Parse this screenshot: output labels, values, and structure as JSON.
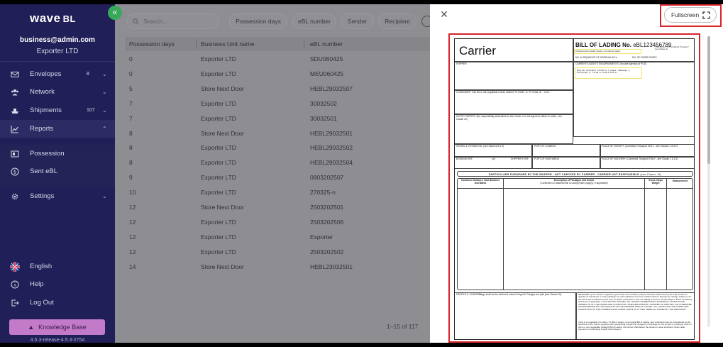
{
  "brand": {
    "name": "wave",
    "suffix": "BL"
  },
  "collapse_icon": "double-chevron-left-icon",
  "account": {
    "email": "business@admin.com",
    "company": "Exporter LTD"
  },
  "nav": [
    {
      "label": "Envelopes",
      "count": "8",
      "icon": "envelope-icon"
    },
    {
      "label": "Network",
      "count": "",
      "icon": "network-icon"
    },
    {
      "label": "Shipments",
      "count": "107",
      "icon": "ship-icon"
    },
    {
      "label": "Reports",
      "count": "",
      "icon": "chart-icon"
    },
    {
      "label": "Possession",
      "icon": "possession-icon"
    },
    {
      "label": "Sent eBL",
      "icon": "dollar-icon"
    },
    {
      "label": "Settings",
      "icon": "gear-icon"
    }
  ],
  "bottom_nav": [
    {
      "label": "English",
      "icon": "uk-flag-icon"
    },
    {
      "label": "Help",
      "icon": "help-icon"
    },
    {
      "label": "Log Out",
      "icon": "logout-icon"
    }
  ],
  "knowledge_base": "Knowledge Base",
  "version": "4.5.3-release-4.5.3-2754",
  "search": {
    "placeholder": "Search..."
  },
  "filters": [
    "Possession days",
    "eBL number",
    "Sender",
    "Recipient"
  ],
  "table": {
    "columns": [
      "Possession days",
      "Business Unit name",
      "eBL number"
    ],
    "rows": [
      [
        "0",
        "Exporter LTD",
        "SDU060425"
      ],
      [
        "0",
        "Exporter LTD",
        "MEU060425"
      ],
      [
        "5",
        "Store Next Door",
        "HEBL29032507"
      ],
      [
        "7",
        "Exporter LTD",
        "30032502"
      ],
      [
        "7",
        "Exporter LTD",
        "30032501"
      ],
      [
        "8",
        "Store Next Door",
        "HEBL29032501"
      ],
      [
        "8",
        "Exporter LTD",
        "HEBL29032502"
      ],
      [
        "8",
        "Exporter LTD",
        "HEBL29032504"
      ],
      [
        "9",
        "Exporter LTD",
        "0803202507"
      ],
      [
        "10",
        "Exporter LTD",
        "270325-n"
      ],
      [
        "12",
        "Store Next Door",
        "2503202501"
      ],
      [
        "12",
        "Exporter LTD",
        "2503202506"
      ],
      [
        "12",
        "Exporter LTD",
        "Exporter"
      ],
      [
        "12",
        "Exporter LTD",
        "2503202502"
      ],
      [
        "14",
        "Store Next Door",
        "HEBL23032501"
      ]
    ]
  },
  "pagination": "1–15 of 117",
  "panel": {
    "fullscreen": "Fullscreen"
  },
  "document": {
    "carrier": "Carrier",
    "title": "BILL OF LADING No.",
    "number": "eBL123456789",
    "port_note": "\"Port-to-Port\" or \"Combined Transport\" (see Clause 1)",
    "original_note": "Original electronically issued, not valid as paper",
    "shipper": "SHIPPER:",
    "seq": "NO. & SEQUENCE OF ORIGINAL B/L's",
    "rider": "NO. OF RIDER PAGES",
    "endorse": "CARRIER'S AGENTS ENDORSEMENTS: (Include Agent(s) at POD)",
    "digital_note": "Digital Document contains 3 pages (Message 1, Riderpage 0, Terms & Conditions 2)",
    "consignee": "CONSIGNEE: This B/L is not negotiable unless marked \"To Order\" or \"To Order of...\" here.",
    "notify": "NOTIFY PARTIES: (No responsibility shall attach to the Carrier or to his Agent for failure to notify - see Clause 20)",
    "vessel": "VESSEL & VOYAGE NO. (see Clauses 8 & 9)",
    "port_loading": "PORT OF LOADING",
    "place_receipt": "PLACE OF RECEIPT: (Combined Transport ONLY - see Clauses 1 & 5.2)",
    "booking": "BOOKING REF.",
    "or": "(or)",
    "shippers_ref": "SHIPPER'S REF.",
    "port_discharge": "PORT OF DISCHARGE",
    "place_delivery": "PLACE OF DELIVERY: (Combined Transport ONLY - see Clause 1 & 5.2)",
    "particulars": "PARTICULARS FURNISHED BY THE SHIPPER - NOT CHECKED BY CARRIER - CARRIER NOT RESPONSIBLE",
    "particulars_note": "(see Clause 14)",
    "col_container": "Container Numbers, Seal Numbers and Marks",
    "col_description": "Description of Packages and Goods",
    "col_description_sub": "(Continued on attached Bill of Lading Rider page(s), if applicable)",
    "col_weight": "Gross Cargo Weight",
    "col_measure": "Measurement",
    "freight": "FREIGHT & CHARGES",
    "freight_note": "Cargo shall not be delivered unless Freight & Charges are paid (see Clause 16).",
    "received": "RECEIVED by the Carrier in apparent good order and condition (unless otherwise stated herein) the total number or quantity of Containers or other packages or units indicated in the box entitled Carrier's Receipt for carriage subject to all the terms and conditions hereof from the Place of Receipt or Port of Loading to the Port of Discharge or Place of Delivery, whichever is applicable. IN ACCEPTING THIS BILL OF LADING THE MERCHANT EXPRESSLY ACCEPTS AND AGREES TO ALL THE TERMS AND CONDITIONS, WHETHER PRINTED, STAMPED OR WRITTEN, OR OTHERWISE INCORPORATED ON THIS SIDE AND ON THE REVERSE SIDE OF THIS BILL OF LADING AND THE TERMS AND CONDITIONS OF THE CARRIER'S APPLICABLE TARIFF AS IF THEY WERE ALL SIGNED BY THE MERCHANT.",
    "negotiable": "If this is a negotiable (To Order / of) Bill of Lading, one original Bill of Lading, duly endorsed must be surrendered by the Merchant to the Carrier (together with outstanding Freight and charges) in exchange for the Goods or a Delivery Order. If this is a non-negotiable (straight) Bill of Lading, the Carrier shall deliver the Goods or issue a Delivery Order (after payment of outstanding Freight and charges)"
  }
}
